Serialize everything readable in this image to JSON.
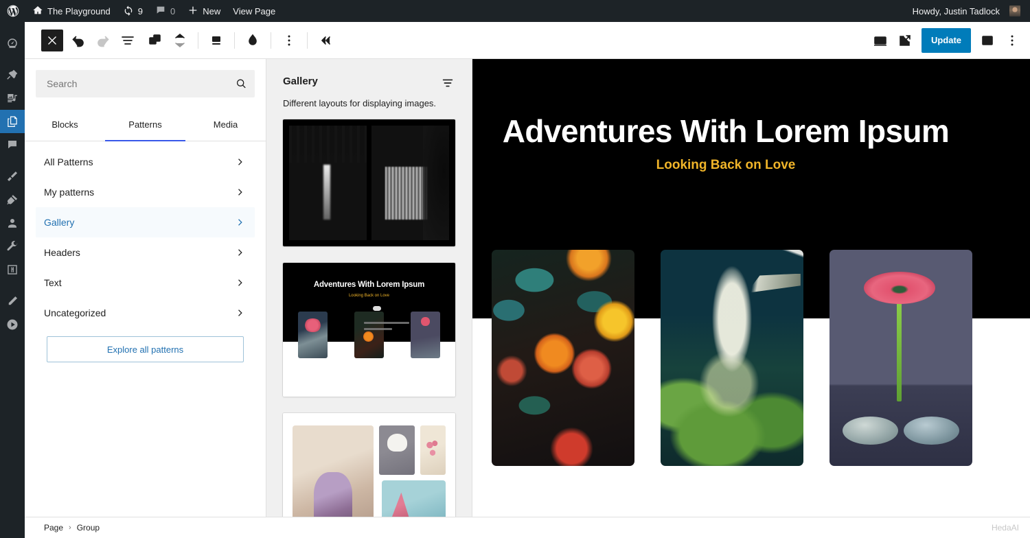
{
  "adminbar": {
    "logo_icon": "wordpress-logo-icon",
    "site_icon": "home-icon",
    "site_name": "The Playground",
    "updates_icon": "updates-icon",
    "updates_count": "9",
    "comments_icon": "comment-bubble-icon",
    "comments_count": "0",
    "new_icon": "plus-icon",
    "new_label": "New",
    "view_page_label": "View Page",
    "howdy": "Howdy, Justin Tadlock",
    "avatar_icon": "avatar"
  },
  "adminmenu": {
    "items": [
      {
        "name": "dashboard",
        "icon": "dashboard-gauge-icon",
        "current": false
      },
      {
        "name": "posts",
        "icon": "pin-icon",
        "current": false
      },
      {
        "name": "media",
        "icon": "media-icon",
        "current": false
      },
      {
        "name": "pages",
        "icon": "pages-icon",
        "current": true
      },
      {
        "name": "comments",
        "icon": "comment-bubble-icon",
        "current": false
      },
      {
        "name": "appearance",
        "icon": "paintbrush-icon",
        "current": false
      },
      {
        "name": "plugins",
        "icon": "plug-icon",
        "current": false
      },
      {
        "name": "users",
        "icon": "user-icon",
        "current": false
      },
      {
        "name": "tools",
        "icon": "wrench-icon",
        "current": false
      },
      {
        "name": "settings",
        "icon": "settings-sliders-icon",
        "current": false
      },
      {
        "name": "editor",
        "icon": "pencil-icon",
        "current": false
      },
      {
        "name": "player",
        "icon": "play-circle-icon",
        "current": false
      }
    ]
  },
  "toolbar": {
    "close_icon": "close-x-icon",
    "undo_icon": "undo-arrow-icon",
    "redo_icon": "redo-arrow-icon",
    "list_view_icon": "list-view-icon",
    "patterns_icon": "copy-blocks-icon",
    "stepper_icon": "chevron-up-down-icon",
    "style_icon": "block-style-icon",
    "color_icon": "droplet-icon",
    "options_icon": "vertical-dots-icon",
    "collapse_icon": "double-chevron-left-icon",
    "device_icon": "desktop-preview-icon",
    "view_icon": "external-link-icon",
    "update_label": "Update",
    "sidebar_icon": "settings-sidebar-icon",
    "more_icon": "vertical-dots-icon"
  },
  "inserter": {
    "search": {
      "placeholder": "Search",
      "value": "",
      "icon": "search-icon"
    },
    "tabs": [
      {
        "label": "Blocks",
        "active": false
      },
      {
        "label": "Patterns",
        "active": true
      },
      {
        "label": "Media",
        "active": false
      }
    ],
    "categories": [
      {
        "label": "All Patterns",
        "active": false
      },
      {
        "label": "My patterns",
        "active": false
      },
      {
        "label": "Gallery",
        "active": true
      },
      {
        "label": "Headers",
        "active": false
      },
      {
        "label": "Text",
        "active": false
      },
      {
        "label": "Uncategorized",
        "active": false
      }
    ],
    "chevron_icon": "chevron-right-icon",
    "explore_label": "Explore all patterns"
  },
  "pattern_panel": {
    "title": "Gallery",
    "filter_icon": "filter-icon",
    "description": "Different layouts for displaying images.",
    "patterns": [
      {
        "name": "two-waterfalls-black-and-white"
      },
      {
        "name": "adventures-hero-with-images",
        "heading": "Adventures With Lorem Ipsum",
        "subheading": "Looking Back on Love"
      },
      {
        "name": "vintage-japanese-image-grid"
      }
    ]
  },
  "canvas": {
    "hero": {
      "heading": "Adventures With Lorem Ipsum",
      "subheading": "Looking Back on Love"
    },
    "gallery": [
      {
        "name": "orange-flowers-dark-foliage"
      },
      {
        "name": "watering-can-green-plants"
      },
      {
        "name": "pink-gerbera-on-stones"
      }
    ]
  },
  "footer": {
    "breadcrumbs": [
      "Page",
      "Group"
    ],
    "separator": "›",
    "watermark": "HedaAI"
  }
}
